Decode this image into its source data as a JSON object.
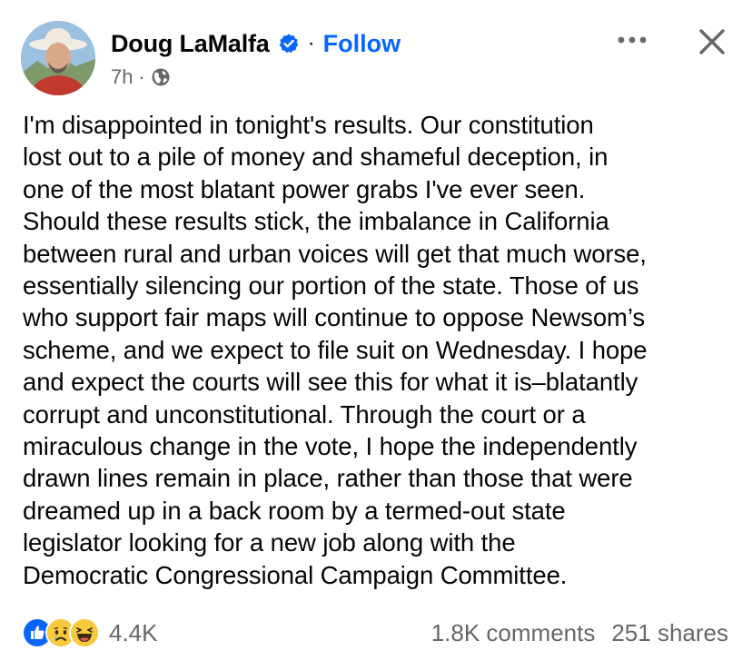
{
  "post": {
    "author": "Doug LaMalfa",
    "verified_icon": "verified-badge-icon",
    "separator": "·",
    "follow_label": "Follow",
    "time": "7h",
    "meta_separator": "·",
    "audience_icon": "globe-icon",
    "more_icon": "more-options-icon",
    "close_icon": "close-icon",
    "text": "I'm disappointed in tonight's results. Our constitution\nlost out to a pile of money and shameful deception, in\none of the most blatant power grabs I've ever seen.\nShould these results stick, the imbalance in California\nbetween rural and urban voices will get that much worse,\nessentially silencing our portion of the state. Those of us\nwho support fair maps will continue to oppose Newsom’s\nscheme, and we expect to file suit on Wednesday. I hope\nand expect the courts will see this for what it is–blatantly\ncorrupt and unconstitutional. Through the court or a\nmiraculous change in the vote, I hope the independently\ndrawn lines remain in place, rather than those that were\ndreamed up in a back room by a termed-out state\nlegislator looking for a new job along with the\nDemocratic Congressional Campaign Committee."
  },
  "footer": {
    "reactions": [
      "like-reaction-icon",
      "sad-reaction-icon",
      "haha-reaction-icon"
    ],
    "reaction_count": "4.4K",
    "comments": "1.8K comments",
    "shares": "251 shares"
  },
  "colors": {
    "accent": "#0866ff",
    "secondary_text": "#65676b",
    "primary_text": "#050505"
  }
}
